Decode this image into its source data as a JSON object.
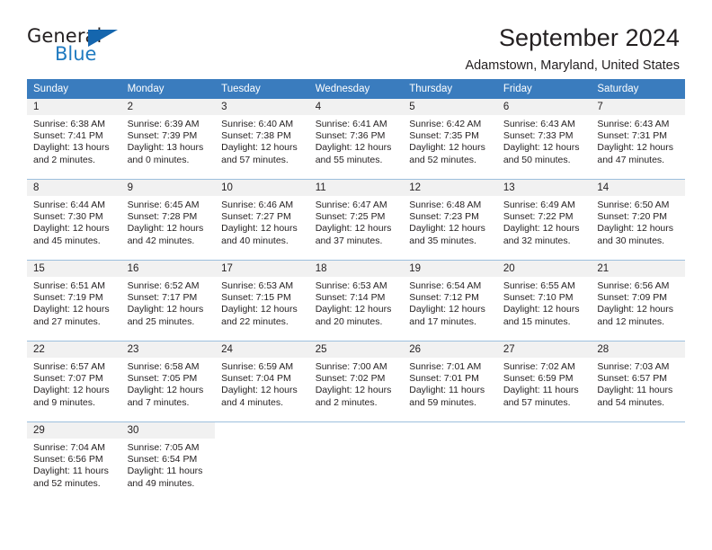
{
  "brand": {
    "name_primary": "General",
    "name_secondary": "Blue",
    "triangle_color": "#1566ae",
    "blue_color": "#1f7ac0"
  },
  "header": {
    "title": "September 2024",
    "subtitle": "Adamstown, Maryland, United States"
  },
  "colors": {
    "header_row_bg": "#3a7cbe",
    "day_number_bg": "#f1f1f1",
    "grid_line": "#9dbfdd",
    "text": "#231f20"
  },
  "weekdays": [
    "Sunday",
    "Monday",
    "Tuesday",
    "Wednesday",
    "Thursday",
    "Friday",
    "Saturday"
  ],
  "labels": {
    "sunrise_prefix": "Sunrise:",
    "sunset_prefix": "Sunset:",
    "daylight_prefix": "Daylight:"
  },
  "weeks": [
    [
      {
        "day": "1",
        "sunrise": "Sunrise: 6:38 AM",
        "sunset": "Sunset: 7:41 PM",
        "daylight_line1": "Daylight: 13 hours",
        "daylight_line2": "and 2 minutes."
      },
      {
        "day": "2",
        "sunrise": "Sunrise: 6:39 AM",
        "sunset": "Sunset: 7:39 PM",
        "daylight_line1": "Daylight: 13 hours",
        "daylight_line2": "and 0 minutes."
      },
      {
        "day": "3",
        "sunrise": "Sunrise: 6:40 AM",
        "sunset": "Sunset: 7:38 PM",
        "daylight_line1": "Daylight: 12 hours",
        "daylight_line2": "and 57 minutes."
      },
      {
        "day": "4",
        "sunrise": "Sunrise: 6:41 AM",
        "sunset": "Sunset: 7:36 PM",
        "daylight_line1": "Daylight: 12 hours",
        "daylight_line2": "and 55 minutes."
      },
      {
        "day": "5",
        "sunrise": "Sunrise: 6:42 AM",
        "sunset": "Sunset: 7:35 PM",
        "daylight_line1": "Daylight: 12 hours",
        "daylight_line2": "and 52 minutes."
      },
      {
        "day": "6",
        "sunrise": "Sunrise: 6:43 AM",
        "sunset": "Sunset: 7:33 PM",
        "daylight_line1": "Daylight: 12 hours",
        "daylight_line2": "and 50 minutes."
      },
      {
        "day": "7",
        "sunrise": "Sunrise: 6:43 AM",
        "sunset": "Sunset: 7:31 PM",
        "daylight_line1": "Daylight: 12 hours",
        "daylight_line2": "and 47 minutes."
      }
    ],
    [
      {
        "day": "8",
        "sunrise": "Sunrise: 6:44 AM",
        "sunset": "Sunset: 7:30 PM",
        "daylight_line1": "Daylight: 12 hours",
        "daylight_line2": "and 45 minutes."
      },
      {
        "day": "9",
        "sunrise": "Sunrise: 6:45 AM",
        "sunset": "Sunset: 7:28 PM",
        "daylight_line1": "Daylight: 12 hours",
        "daylight_line2": "and 42 minutes."
      },
      {
        "day": "10",
        "sunrise": "Sunrise: 6:46 AM",
        "sunset": "Sunset: 7:27 PM",
        "daylight_line1": "Daylight: 12 hours",
        "daylight_line2": "and 40 minutes."
      },
      {
        "day": "11",
        "sunrise": "Sunrise: 6:47 AM",
        "sunset": "Sunset: 7:25 PM",
        "daylight_line1": "Daylight: 12 hours",
        "daylight_line2": "and 37 minutes."
      },
      {
        "day": "12",
        "sunrise": "Sunrise: 6:48 AM",
        "sunset": "Sunset: 7:23 PM",
        "daylight_line1": "Daylight: 12 hours",
        "daylight_line2": "and 35 minutes."
      },
      {
        "day": "13",
        "sunrise": "Sunrise: 6:49 AM",
        "sunset": "Sunset: 7:22 PM",
        "daylight_line1": "Daylight: 12 hours",
        "daylight_line2": "and 32 minutes."
      },
      {
        "day": "14",
        "sunrise": "Sunrise: 6:50 AM",
        "sunset": "Sunset: 7:20 PM",
        "daylight_line1": "Daylight: 12 hours",
        "daylight_line2": "and 30 minutes."
      }
    ],
    [
      {
        "day": "15",
        "sunrise": "Sunrise: 6:51 AM",
        "sunset": "Sunset: 7:19 PM",
        "daylight_line1": "Daylight: 12 hours",
        "daylight_line2": "and 27 minutes."
      },
      {
        "day": "16",
        "sunrise": "Sunrise: 6:52 AM",
        "sunset": "Sunset: 7:17 PM",
        "daylight_line1": "Daylight: 12 hours",
        "daylight_line2": "and 25 minutes."
      },
      {
        "day": "17",
        "sunrise": "Sunrise: 6:53 AM",
        "sunset": "Sunset: 7:15 PM",
        "daylight_line1": "Daylight: 12 hours",
        "daylight_line2": "and 22 minutes."
      },
      {
        "day": "18",
        "sunrise": "Sunrise: 6:53 AM",
        "sunset": "Sunset: 7:14 PM",
        "daylight_line1": "Daylight: 12 hours",
        "daylight_line2": "and 20 minutes."
      },
      {
        "day": "19",
        "sunrise": "Sunrise: 6:54 AM",
        "sunset": "Sunset: 7:12 PM",
        "daylight_line1": "Daylight: 12 hours",
        "daylight_line2": "and 17 minutes."
      },
      {
        "day": "20",
        "sunrise": "Sunrise: 6:55 AM",
        "sunset": "Sunset: 7:10 PM",
        "daylight_line1": "Daylight: 12 hours",
        "daylight_line2": "and 15 minutes."
      },
      {
        "day": "21",
        "sunrise": "Sunrise: 6:56 AM",
        "sunset": "Sunset: 7:09 PM",
        "daylight_line1": "Daylight: 12 hours",
        "daylight_line2": "and 12 minutes."
      }
    ],
    [
      {
        "day": "22",
        "sunrise": "Sunrise: 6:57 AM",
        "sunset": "Sunset: 7:07 PM",
        "daylight_line1": "Daylight: 12 hours",
        "daylight_line2": "and 9 minutes."
      },
      {
        "day": "23",
        "sunrise": "Sunrise: 6:58 AM",
        "sunset": "Sunset: 7:05 PM",
        "daylight_line1": "Daylight: 12 hours",
        "daylight_line2": "and 7 minutes."
      },
      {
        "day": "24",
        "sunrise": "Sunrise: 6:59 AM",
        "sunset": "Sunset: 7:04 PM",
        "daylight_line1": "Daylight: 12 hours",
        "daylight_line2": "and 4 minutes."
      },
      {
        "day": "25",
        "sunrise": "Sunrise: 7:00 AM",
        "sunset": "Sunset: 7:02 PM",
        "daylight_line1": "Daylight: 12 hours",
        "daylight_line2": "and 2 minutes."
      },
      {
        "day": "26",
        "sunrise": "Sunrise: 7:01 AM",
        "sunset": "Sunset: 7:01 PM",
        "daylight_line1": "Daylight: 11 hours",
        "daylight_line2": "and 59 minutes."
      },
      {
        "day": "27",
        "sunrise": "Sunrise: 7:02 AM",
        "sunset": "Sunset: 6:59 PM",
        "daylight_line1": "Daylight: 11 hours",
        "daylight_line2": "and 57 minutes."
      },
      {
        "day": "28",
        "sunrise": "Sunrise: 7:03 AM",
        "sunset": "Sunset: 6:57 PM",
        "daylight_line1": "Daylight: 11 hours",
        "daylight_line2": "and 54 minutes."
      }
    ],
    [
      {
        "day": "29",
        "sunrise": "Sunrise: 7:04 AM",
        "sunset": "Sunset: 6:56 PM",
        "daylight_line1": "Daylight: 11 hours",
        "daylight_line2": "and 52 minutes."
      },
      {
        "day": "30",
        "sunrise": "Sunrise: 7:05 AM",
        "sunset": "Sunset: 6:54 PM",
        "daylight_line1": "Daylight: 11 hours",
        "daylight_line2": "and 49 minutes."
      },
      {
        "day": "",
        "sunrise": "",
        "sunset": "",
        "daylight_line1": "",
        "daylight_line2": ""
      },
      {
        "day": "",
        "sunrise": "",
        "sunset": "",
        "daylight_line1": "",
        "daylight_line2": ""
      },
      {
        "day": "",
        "sunrise": "",
        "sunset": "",
        "daylight_line1": "",
        "daylight_line2": ""
      },
      {
        "day": "",
        "sunrise": "",
        "sunset": "",
        "daylight_line1": "",
        "daylight_line2": ""
      },
      {
        "day": "",
        "sunrise": "",
        "sunset": "",
        "daylight_line1": "",
        "daylight_line2": ""
      }
    ]
  ]
}
